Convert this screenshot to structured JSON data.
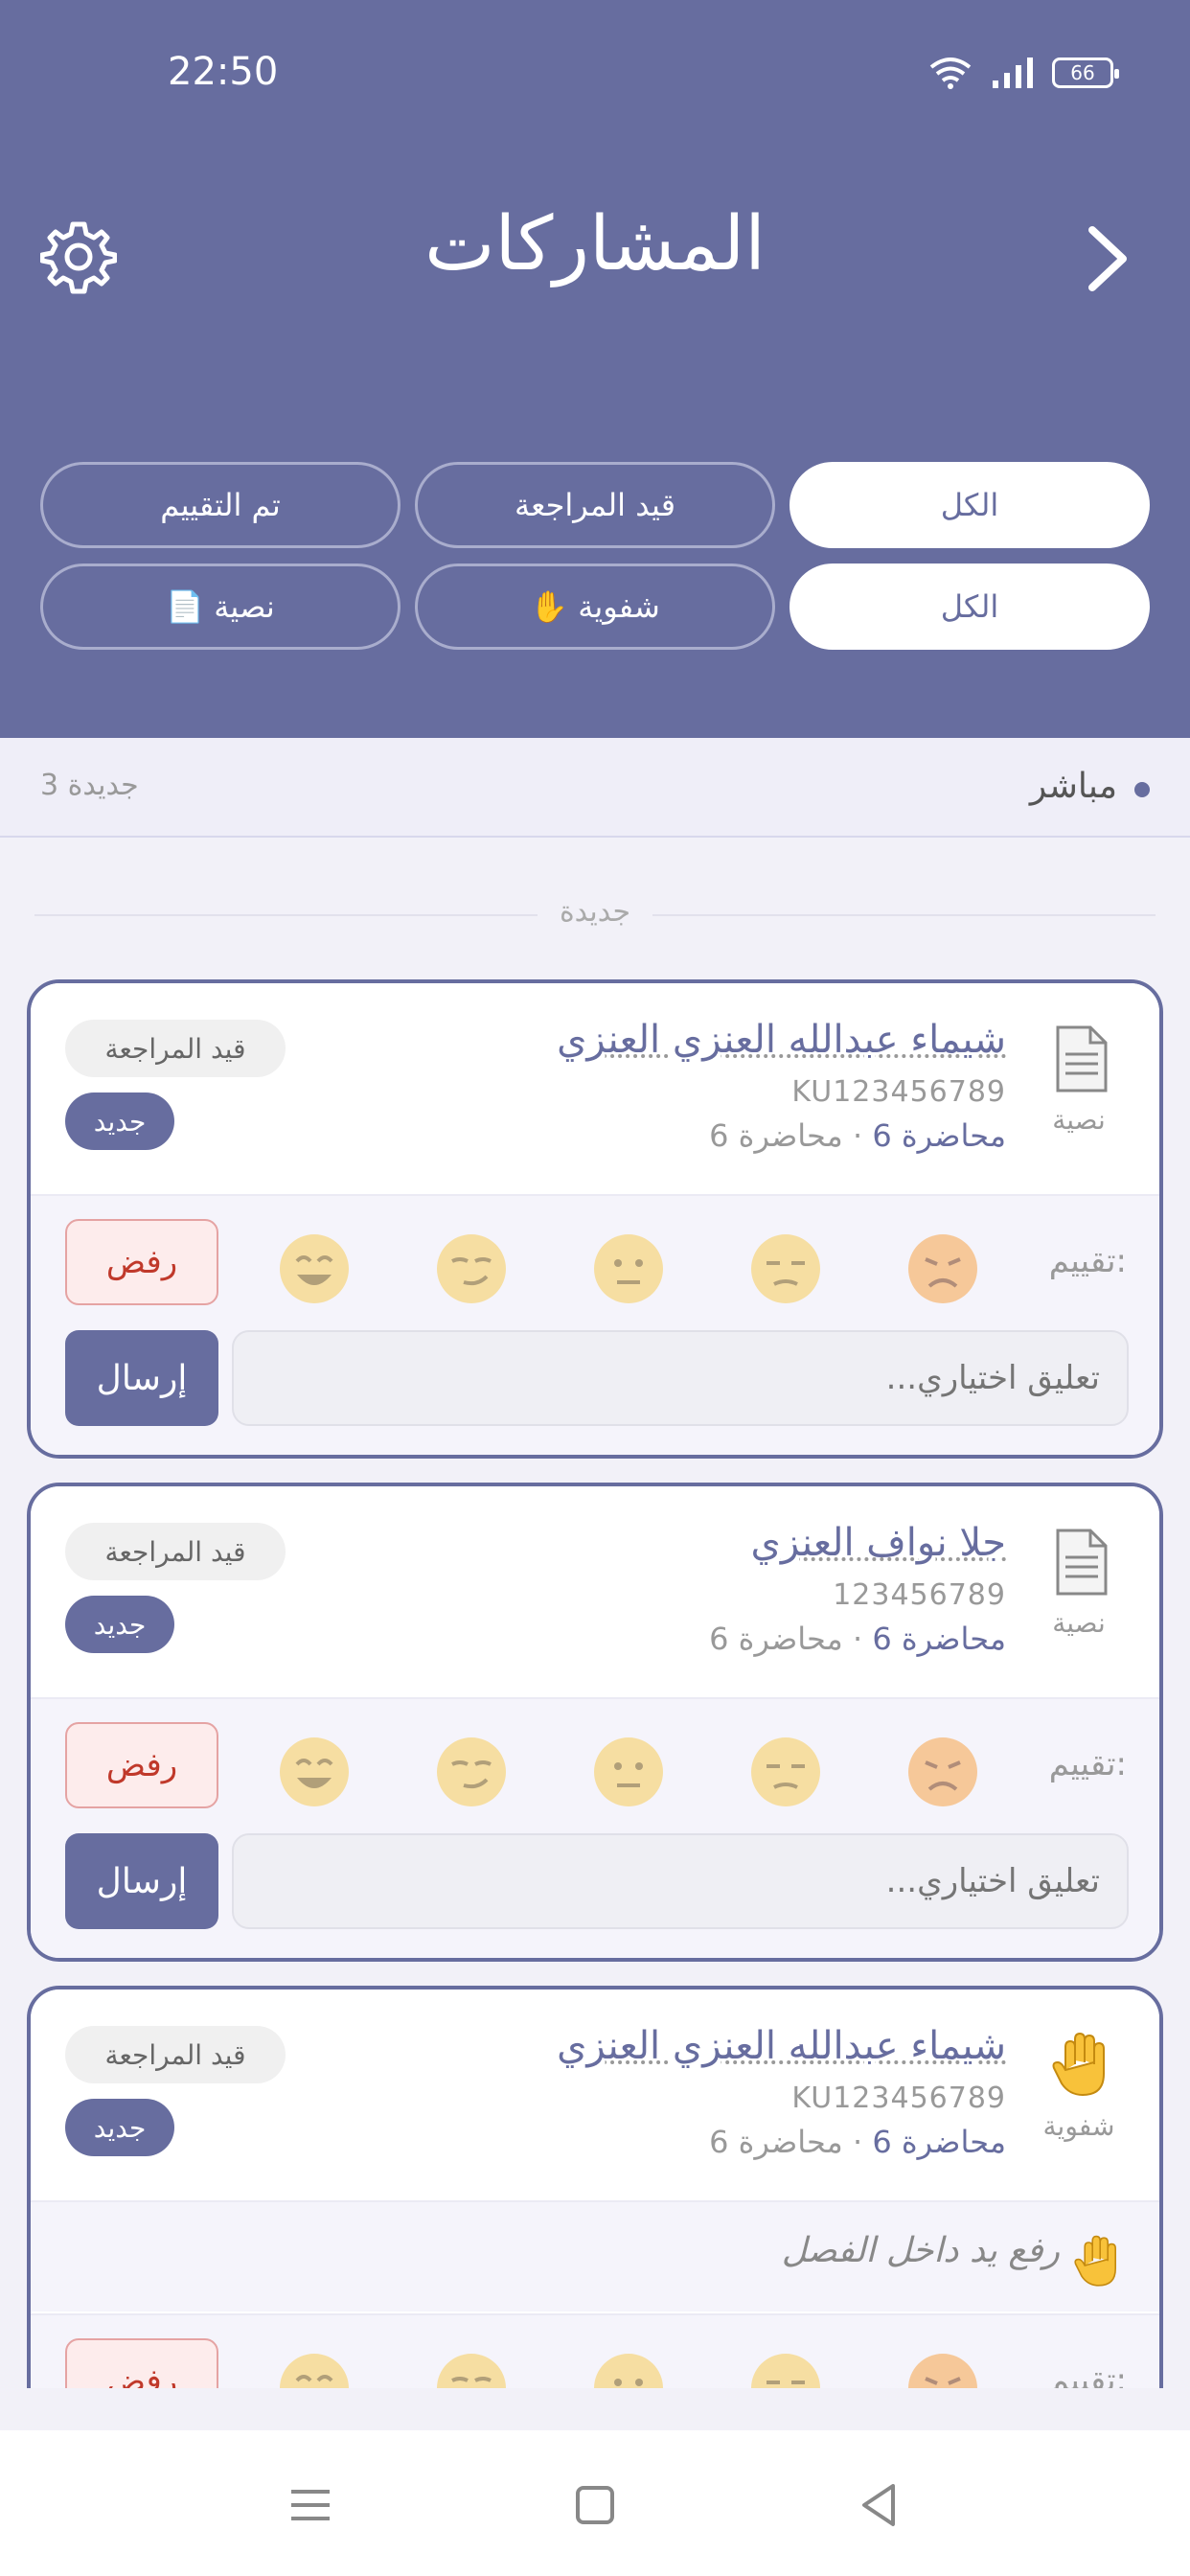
{
  "status": {
    "time": "22:50",
    "battery": "66"
  },
  "header": {
    "title": "المشاركات"
  },
  "filters": {
    "status": [
      "الكل",
      "قيد المراجعة",
      "تم التقييم"
    ],
    "type": [
      "الكل",
      "✋ شفوية",
      "📄 نصية"
    ]
  },
  "live": {
    "label": "مباشر",
    "count": "3 جديدة"
  },
  "section": {
    "label": "جديدة"
  },
  "cards": [
    {
      "name": "شيماء عبدالله العنزي العنزي",
      "id": "KU123456789",
      "lecture": "محاضرة 6",
      "lecture_sub": "· محاضرة 6",
      "type": "نصية",
      "type_icon": "document-icon",
      "review_badge": "قيد المراجعة",
      "new_badge": "جديد",
      "rating_label": "تقييم:",
      "reject": "رفض",
      "comment_placeholder": "تعليق اختياري...",
      "send": "إرسال"
    },
    {
      "name": "جلا نواف العنزي",
      "id": "123456789",
      "lecture": "محاضرة 6",
      "lecture_sub": "· محاضرة 6",
      "type": "نصية",
      "type_icon": "document-icon",
      "review_badge": "قيد المراجعة",
      "new_badge": "جديد",
      "rating_label": "تقييم:",
      "reject": "رفض",
      "comment_placeholder": "تعليق اختياري...",
      "send": "إرسال"
    },
    {
      "name": "شيماء عبدالله العنزي العنزي",
      "id": "KU123456789",
      "lecture": "محاضرة 6",
      "lecture_sub": "· محاضرة 6",
      "type": "شفوية",
      "type_icon": "raised-hand-icon",
      "review_badge": "قيد المراجعة",
      "new_badge": "جديد",
      "note": "رفع يد داخل الفصل",
      "rating_label": "تقييم:",
      "reject": "رفض"
    }
  ],
  "colors": {
    "primary": "#676d9f",
    "reject": "#c0392b",
    "background": "#f2f1f8"
  }
}
